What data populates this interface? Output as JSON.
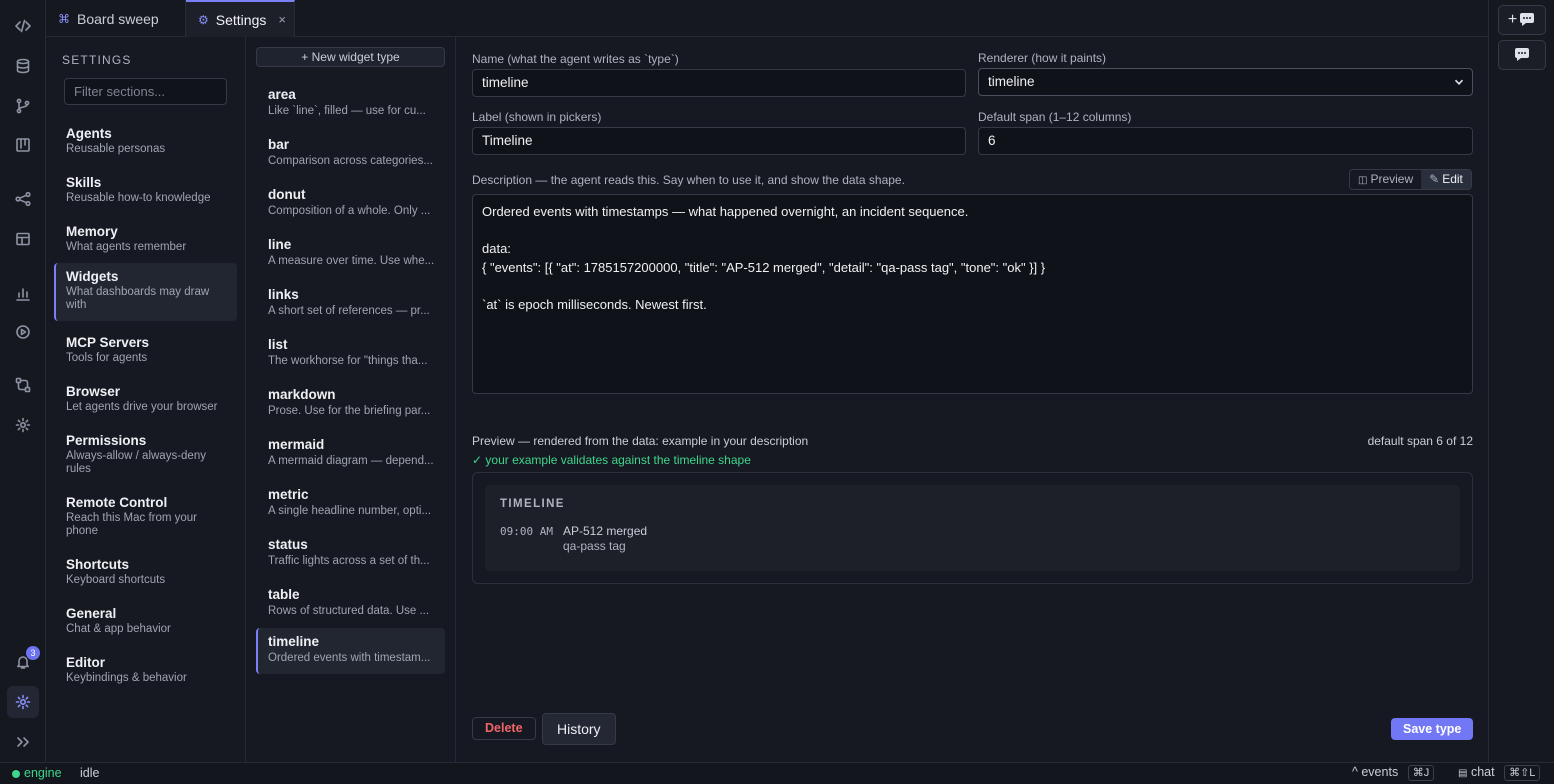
{
  "tabs": [
    {
      "icon": "⌘",
      "label": "Board sweep"
    },
    {
      "icon": "⚙",
      "label": "Settings",
      "close": "×"
    }
  ],
  "rail": {
    "notifications_count": "3"
  },
  "settings": {
    "heading": "SETTINGS",
    "filter_placeholder": "Filter sections...",
    "sections": [
      {
        "title": "Agents",
        "desc": "Reusable personas"
      },
      {
        "title": "Skills",
        "desc": "Reusable how-to knowledge"
      },
      {
        "title": "Memory",
        "desc": "What agents remember"
      },
      {
        "title": "Widgets",
        "desc": "What dashboards may draw with"
      },
      {
        "title": "MCP Servers",
        "desc": "Tools for agents"
      },
      {
        "title": "Browser",
        "desc": "Let agents drive your browser"
      },
      {
        "title": "Permissions",
        "desc": "Always-allow / always-deny rules"
      },
      {
        "title": "Remote Control",
        "desc": "Reach this Mac from your phone"
      },
      {
        "title": "Shortcuts",
        "desc": "Keyboard shortcuts"
      },
      {
        "title": "General",
        "desc": "Chat & app behavior"
      },
      {
        "title": "Editor",
        "desc": "Keybindings & behavior"
      }
    ]
  },
  "widgets": {
    "new_button": "+ New widget type",
    "items": [
      {
        "name": "area",
        "desc": "Like `line`, filled — use for cu..."
      },
      {
        "name": "bar",
        "desc": "Comparison across categories..."
      },
      {
        "name": "donut",
        "desc": "Composition of a whole. Only ..."
      },
      {
        "name": "line",
        "desc": "A measure over time. Use whe..."
      },
      {
        "name": "links",
        "desc": "A short set of references — pr..."
      },
      {
        "name": "list",
        "desc": "The workhorse for \"things tha..."
      },
      {
        "name": "markdown",
        "desc": "Prose. Use for the briefing par..."
      },
      {
        "name": "mermaid",
        "desc": "A mermaid diagram — depend..."
      },
      {
        "name": "metric",
        "desc": "A single headline number, opti..."
      },
      {
        "name": "status",
        "desc": "Traffic lights across a set of th..."
      },
      {
        "name": "table",
        "desc": "Rows of structured data. Use ..."
      },
      {
        "name": "timeline",
        "desc": "Ordered events with timestam..."
      }
    ]
  },
  "editor": {
    "name_label": "Name (what the agent writes as `type`)",
    "name_value": "timeline",
    "renderer_label": "Renderer (how it paints)",
    "renderer_value": "timeline",
    "label_label": "Label (shown in pickers)",
    "label_value": "Timeline",
    "span_label": "Default span (1–12 columns)",
    "span_value": "6",
    "desc_label": "Description — the agent reads this. Say when to use it, and show the data shape.",
    "preview_toggle": "Preview",
    "edit_toggle": "Edit",
    "description": "Ordered events with timestamps — what happened overnight, an incident sequence.\n\ndata:\n{ \"events\": [{ \"at\": 1785157200000, \"title\": \"AP-512 merged\", \"detail\": \"qa-pass tag\", \"tone\": \"ok\" }] }\n\n`at` is epoch milliseconds. Newest first.",
    "preview_heading": "Preview — rendered from the data: example in your description",
    "preview_span": "default span 6 of 12",
    "validation": "✓ your example validates against the timeline shape",
    "preview": {
      "title": "TIMELINE",
      "time": "09:00 AM",
      "event_title": "AP-512 merged",
      "event_detail": "qa-pass tag"
    },
    "delete_button": "Delete",
    "history_button": "History",
    "save_button": "Save type"
  },
  "status": {
    "engine": "engine",
    "state": "idle",
    "events_label": "events",
    "events_kbd": "⌘J",
    "chat_label": "chat",
    "chat_kbd": "⌘⇧L"
  },
  "colors": {
    "accent": "#7278f5",
    "ok": "#3dd68c",
    "danger": "#f0656a"
  }
}
